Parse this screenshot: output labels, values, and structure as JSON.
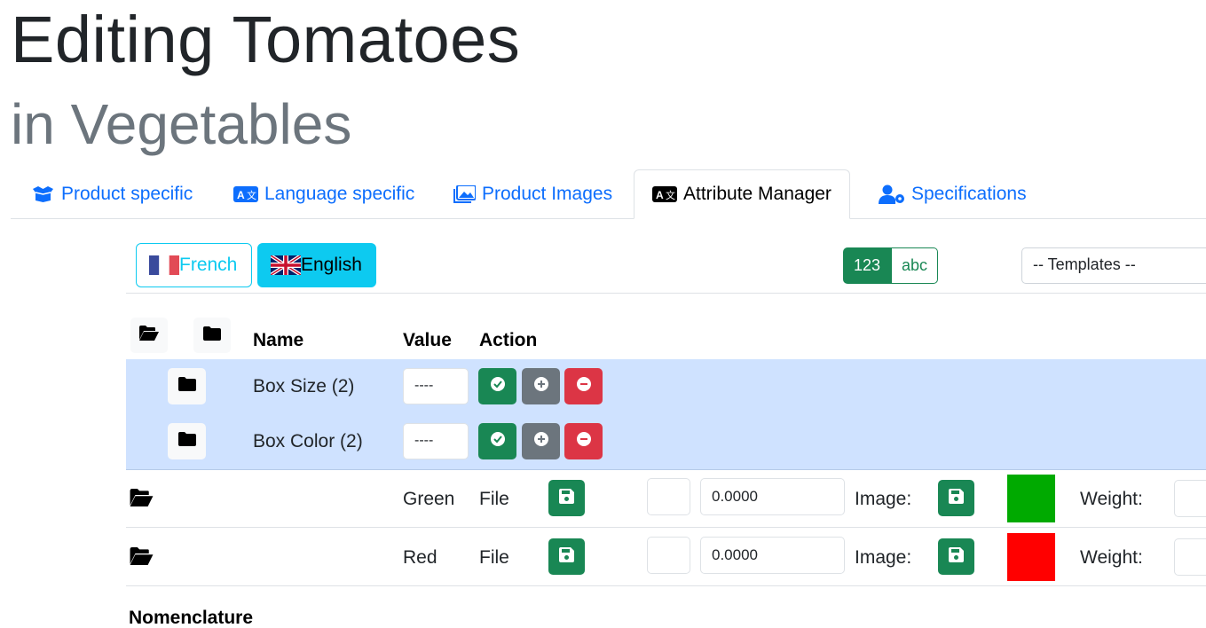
{
  "page": {
    "title": "Editing Tomatoes",
    "subtitle": "in Vegetables"
  },
  "tabs": [
    {
      "label": "Product specific",
      "icon": "box-icon"
    },
    {
      "label": "Language specific",
      "icon": "language-icon"
    },
    {
      "label": "Product Images",
      "icon": "images-icon"
    },
    {
      "label": "Attribute Manager",
      "icon": "language-icon",
      "active": true
    },
    {
      "label": "Specifications",
      "icon": "user-gear-icon"
    }
  ],
  "languages": [
    {
      "label": "French",
      "flag": "fr-flag"
    },
    {
      "label": "English",
      "flag": "gb-flag",
      "active": true
    }
  ],
  "toggle": {
    "numeric": "123",
    "alpha": "abc",
    "selected": "123"
  },
  "templates": {
    "selected": "-- Templates --"
  },
  "table": {
    "headers": {
      "name": "Name",
      "value": "Value",
      "action": "Action"
    },
    "groups": [
      {
        "name": "Box Size (2)",
        "value": "----"
      },
      {
        "name": "Box Color (2)",
        "value": "----"
      }
    ],
    "rows": [
      {
        "name": "Green",
        "file": "File",
        "price": "0.0000",
        "image_label": "Image:",
        "color": "#00aa00",
        "weight_label": "Weight:"
      },
      {
        "name": "Red",
        "file": "File",
        "price": "0.0000",
        "image_label": "Image:",
        "color": "#ff0000",
        "weight_label": "Weight:"
      }
    ]
  },
  "next_section": {
    "label": "Nomenclature"
  },
  "colors": {
    "primary": "#0d6efd",
    "info": "#0dcaf0",
    "success": "#198754",
    "secondary": "#6c757d",
    "danger": "#dc3545",
    "group_bg": "#cfe2ff"
  }
}
